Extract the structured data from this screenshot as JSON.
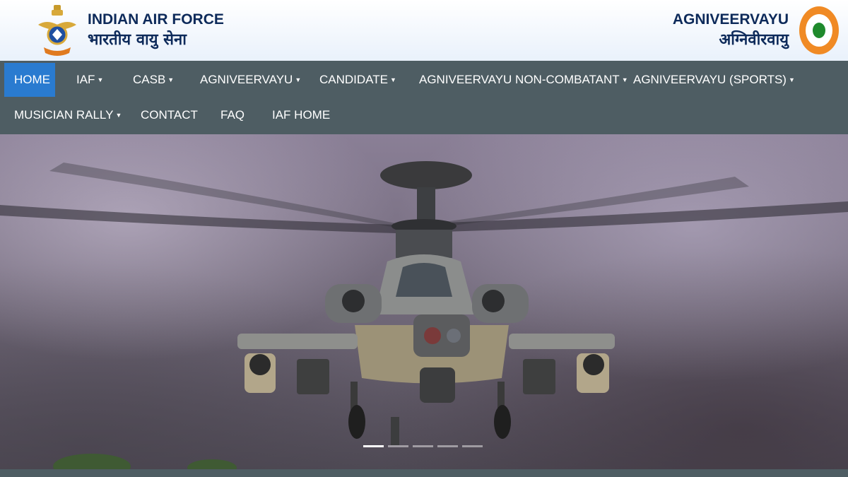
{
  "header": {
    "title_en": "INDIAN AIR FORCE",
    "title_hi": "भारतीय वायु सेना",
    "right_en": "AGNIVEERVAYU",
    "right_hi": "अग्निवीरवायु"
  },
  "nav": {
    "row1": [
      {
        "label": "HOME",
        "dropdown": false,
        "active": true
      },
      {
        "label": "IAF",
        "dropdown": true
      },
      {
        "label": "CASB",
        "dropdown": true
      },
      {
        "label": "AGNIVEERVAYU",
        "dropdown": true
      },
      {
        "label": "CANDIDATE",
        "dropdown": true
      },
      {
        "label": "AGNIVEERVAYU NON-COMBATANT",
        "dropdown": true
      },
      {
        "label": "AGNIVEERVAYU (SPORTS)",
        "dropdown": true
      }
    ],
    "row2": [
      {
        "label": "MUSICIAN RALLY",
        "dropdown": true
      },
      {
        "label": "CONTACT",
        "dropdown": false
      },
      {
        "label": "FAQ",
        "dropdown": false
      },
      {
        "label": "IAF HOME",
        "dropdown": false
      }
    ]
  },
  "carousel": {
    "slide_count": 5,
    "active_index": 0
  },
  "colors": {
    "nav_bg": "#4e5d63",
    "active_bg": "#2a7bd0",
    "brand_text": "#0d2a5a",
    "roundel_outer": "#f08a24",
    "roundel_inner": "#1f8a2c"
  }
}
